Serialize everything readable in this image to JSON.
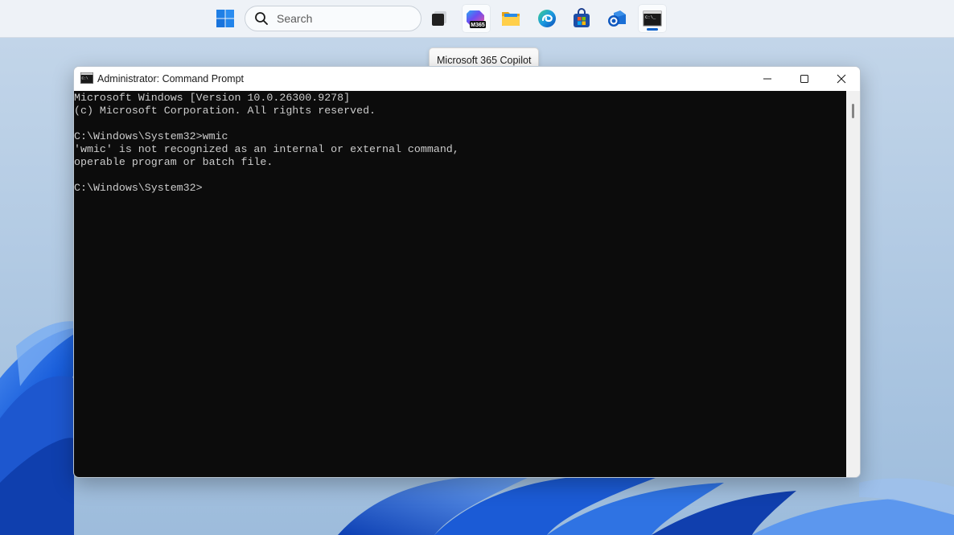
{
  "desktop": {
    "wallpaper": "windows-11-bloom",
    "accent": "#0a5fc8"
  },
  "taskbar": {
    "start_icon": "windows-start-icon",
    "search": {
      "placeholder": "Search",
      "value": ""
    },
    "apps": [
      {
        "name": "task-view-icon",
        "active": false
      },
      {
        "name": "microsoft-365-copilot-icon",
        "badge": "M365",
        "active": false,
        "hovered": true
      },
      {
        "name": "file-explorer-icon",
        "active": false
      },
      {
        "name": "edge-icon",
        "active": false
      },
      {
        "name": "microsoft-store-icon",
        "active": false
      },
      {
        "name": "outlook-icon",
        "active": false
      },
      {
        "name": "command-prompt-icon",
        "active": true
      }
    ],
    "tooltip": "Microsoft 365 Copilot"
  },
  "window": {
    "title": "Administrator: Command Prompt",
    "controls": {
      "minimize": "minimize-icon",
      "maximize": "maximize-icon",
      "close": "close-icon"
    },
    "console": {
      "lines": [
        "Microsoft Windows [Version 10.0.26300.9278]",
        "(c) Microsoft Corporation. All rights reserved.",
        "",
        "C:\\Windows\\System32>wmic",
        "'wmic' is not recognized as an internal or external command,",
        "operable program or batch file.",
        "",
        "C:\\Windows\\System32>"
      ],
      "colors": {
        "background": "#0c0c0c",
        "text": "#cccccc"
      }
    }
  }
}
